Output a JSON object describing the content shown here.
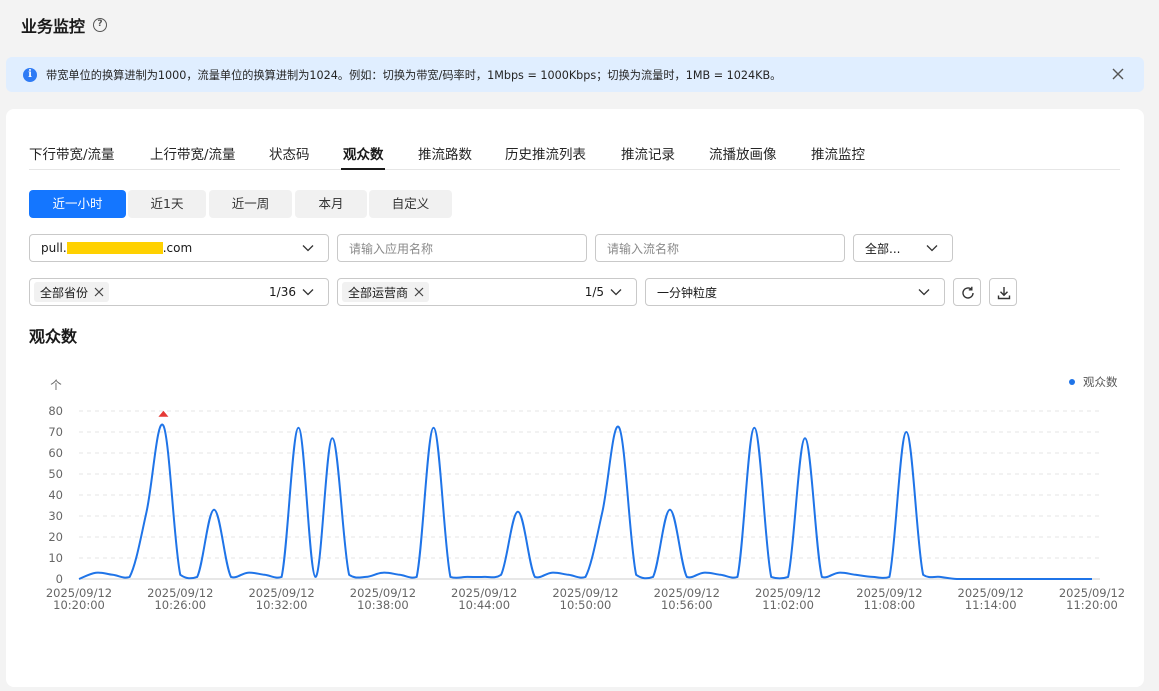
{
  "header": {
    "title": "业务监控",
    "help_icon": "question-circle-icon"
  },
  "notice": {
    "icon": "info-circle-icon",
    "text": "带宽单位的换算进制为1000，流量单位的换算进制为1024。例如：切换为带宽/码率时，1Mbps = 1000Kbps；切换为流量时，1MB = 1024KB。",
    "close_icon": "close-icon"
  },
  "tabs": [
    {
      "label": "下行带宽/流量",
      "active": false
    },
    {
      "label": "上行带宽/流量",
      "active": false
    },
    {
      "label": "状态码",
      "active": false
    },
    {
      "label": "观众数",
      "active": true
    },
    {
      "label": "推流路数",
      "active": false
    },
    {
      "label": "历史推流列表",
      "active": false
    },
    {
      "label": "推流记录",
      "active": false
    },
    {
      "label": "流播放画像",
      "active": false
    },
    {
      "label": "推流监控",
      "active": false
    }
  ],
  "time_ranges": [
    {
      "label": "近一小时",
      "active": true
    },
    {
      "label": "近1天",
      "active": false
    },
    {
      "label": "近一周",
      "active": false
    },
    {
      "label": "本月",
      "active": false
    },
    {
      "label": "自定义",
      "active": false
    }
  ],
  "filters": {
    "domain": {
      "prefix": "pull.",
      "suffix": ".com",
      "redacted": true
    },
    "app_name": {
      "placeholder": "请输入应用名称"
    },
    "stream_name": {
      "placeholder": "请输入流名称"
    },
    "protocol": {
      "value": "全部..."
    },
    "province": {
      "chip": "全部省份",
      "count": "1/36"
    },
    "isp": {
      "chip": "全部运营商",
      "count": "1/5"
    },
    "granularity": {
      "value": "一分钟粒度"
    },
    "refresh_icon": "refresh-icon",
    "download_icon": "download-icon"
  },
  "section": {
    "title": "观众数"
  },
  "colors": {
    "accent": "#1476ff",
    "line": "#1f74e8",
    "peak_marker": "#e53935",
    "notice_bg": "#e0eeff"
  },
  "chart_data": {
    "type": "line",
    "title": "",
    "ylabel": "个",
    "ylim": [
      0,
      80
    ],
    "y_ticks": [
      "0",
      "10",
      "20",
      "30",
      "40",
      "50",
      "60",
      "70",
      "80"
    ],
    "x_ticks": [
      [
        "2025/09/12",
        "10:20:00"
      ],
      [
        "2025/09/12",
        "10:26:00"
      ],
      [
        "2025/09/12",
        "10:32:00"
      ],
      [
        "2025/09/12",
        "10:38:00"
      ],
      [
        "2025/09/12",
        "10:44:00"
      ],
      [
        "2025/09/12",
        "10:50:00"
      ],
      [
        "2025/09/12",
        "10:56:00"
      ],
      [
        "2025/09/12",
        "11:02:00"
      ],
      [
        "2025/09/12",
        "11:08:00"
      ],
      [
        "2025/09/12",
        "11:14:00"
      ],
      [
        "2025/09/12",
        "11:20:00"
      ]
    ],
    "legend": {
      "position": "top-right",
      "entries": [
        "观众数"
      ]
    },
    "series": [
      {
        "name": "观众数",
        "x": [
          "10:20",
          "10:21",
          "10:22",
          "10:23",
          "10:24",
          "10:25",
          "10:26",
          "10:27",
          "10:28",
          "10:29",
          "10:30",
          "10:31",
          "10:32",
          "10:33",
          "10:34",
          "10:35",
          "10:36",
          "10:37",
          "10:38",
          "10:39",
          "10:40",
          "10:41",
          "10:42",
          "10:43",
          "10:44",
          "10:45",
          "10:46",
          "10:47",
          "10:48",
          "10:49",
          "10:50",
          "10:51",
          "10:52",
          "10:53",
          "10:54",
          "10:55",
          "10:56",
          "10:57",
          "10:58",
          "10:59",
          "11:00",
          "11:01",
          "11:02",
          "11:03",
          "11:04",
          "11:05",
          "11:06",
          "11:07",
          "11:08",
          "11:09",
          "11:10",
          "11:11",
          "11:12",
          "11:13",
          "11:14",
          "11:15",
          "11:16",
          "11:17",
          "11:18",
          "11:19",
          "11:20"
        ],
        "values": [
          0,
          3,
          2,
          1,
          32,
          73,
          2,
          1,
          33,
          1,
          3,
          2,
          1,
          72,
          1,
          67,
          2,
          1,
          3,
          2,
          1,
          72,
          1,
          1,
          1,
          2,
          32,
          1,
          3,
          2,
          1,
          32,
          72,
          2,
          1,
          33,
          1,
          3,
          2,
          1,
          72,
          1,
          1,
          67,
          1,
          3,
          2,
          1,
          1,
          70,
          2,
          1,
          0,
          0,
          0,
          0,
          0,
          0,
          0,
          0,
          0
        ],
        "max_marker": {
          "x": "10:25",
          "value": 73
        }
      }
    ]
  }
}
